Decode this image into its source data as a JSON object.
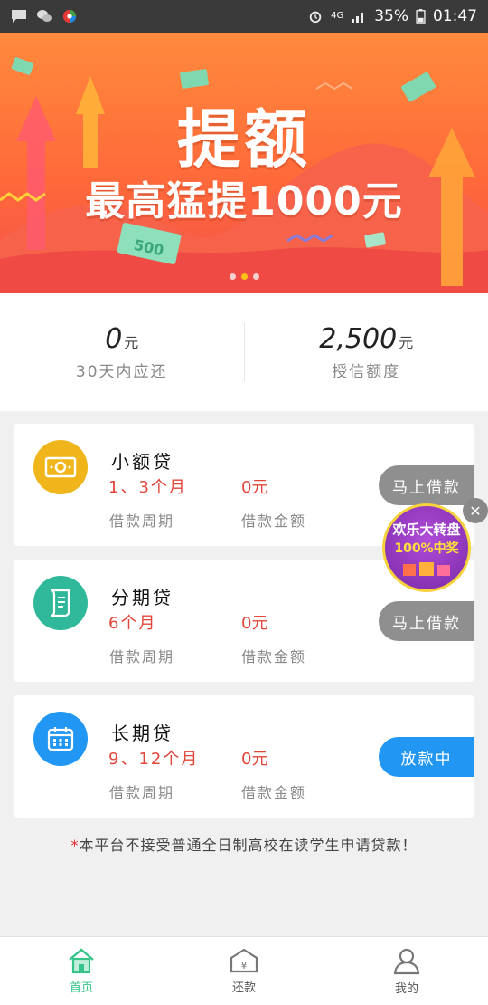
{
  "status_bar": {
    "network": "4G",
    "battery": "35%",
    "time": "01:47",
    "icons": [
      "message-icon",
      "wechat-icon",
      "app-icon",
      "alarm-icon",
      "signal-icon",
      "battery-icon"
    ]
  },
  "banner": {
    "title": "提额",
    "subtitle": "最高猛提1000元",
    "ticket_text": "500",
    "active_dot": 2,
    "colors": {
      "top": "#ff8a3c",
      "bottom": "#f4504a"
    }
  },
  "summary": {
    "due": {
      "value": "0",
      "unit": "元",
      "label": "30天内应还"
    },
    "credit": {
      "value": "2,500",
      "unit": "元",
      "label": "授信额度"
    }
  },
  "loans": [
    {
      "name": "小额贷",
      "period": "1、3个月",
      "amount": "0元",
      "period_label": "借款周期",
      "amount_label": "借款金额",
      "button": "马上借款",
      "icon": "cash-icon",
      "icon_color": "#f0b51a"
    },
    {
      "name": "分期贷",
      "period": "6个月",
      "amount": "0元",
      "period_label": "借款周期",
      "amount_label": "借款金额",
      "button": "马上借款",
      "icon": "scroll-icon",
      "icon_color": "#2fb89a"
    },
    {
      "name": "长期贷",
      "period": "9、12个月",
      "amount": "0元",
      "period_label": "借款周期",
      "amount_label": "借款金额",
      "button": "放款中",
      "icon": "calendar-icon",
      "icon_color": "#2196f3"
    }
  ],
  "notice": {
    "star": "*",
    "text": "本平台不接受普通全日制高校在读学生申请贷款！"
  },
  "promo": {
    "line1": "欢乐大转盘",
    "line2": "100%中奖"
  },
  "nav": [
    {
      "label": "首页",
      "icon": "home-icon",
      "active": true
    },
    {
      "label": "还款",
      "icon": "repay-icon",
      "active": false
    },
    {
      "label": "我的",
      "icon": "profile-icon",
      "active": false
    }
  ],
  "colors": {
    "accent_green": "#36c48a",
    "red_text": "#e2463a",
    "blue": "#2196f3",
    "gray_button": "#8f8f8f"
  }
}
